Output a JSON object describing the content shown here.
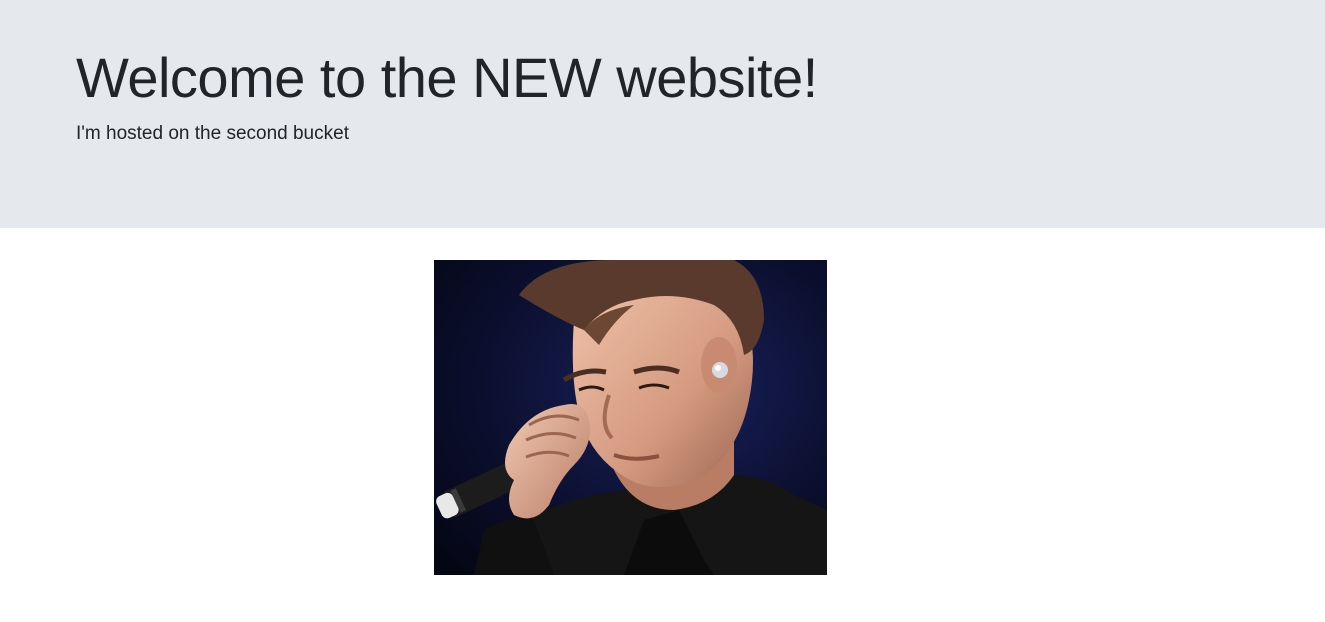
{
  "hero": {
    "title": "Welcome to the NEW website!",
    "subtitle": "I'm hosted on the second bucket"
  },
  "image": {
    "description_icon": "portrait-photo",
    "colors": {
      "background": "#0a0d24",
      "skin": "#d9a58c",
      "hair": "#5a3a2c",
      "jacket": "#141414",
      "microphone": "#1c1c1c"
    }
  },
  "colors": {
    "header_bg": "#e5e8ed",
    "text": "#212529",
    "page_bg": "#ffffff"
  }
}
